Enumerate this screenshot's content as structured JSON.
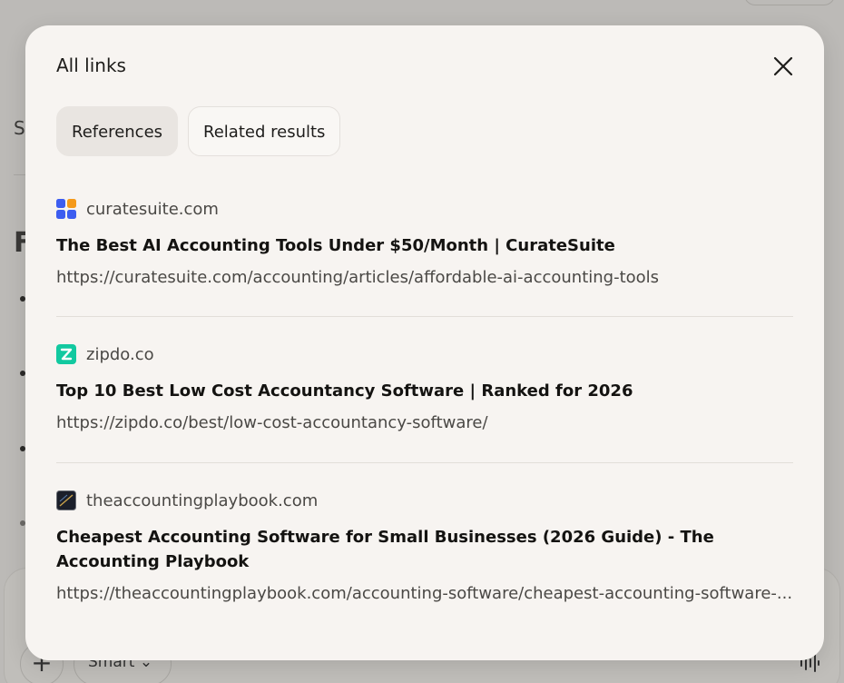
{
  "modal": {
    "title": "All links",
    "close_icon": "close-icon"
  },
  "tabs": [
    {
      "label": "References",
      "active": true
    },
    {
      "label": "Related results",
      "active": false
    }
  ],
  "links": [
    {
      "site": "curatesuite.com",
      "favicon": "curatesuite-logo-icon",
      "title": "The Best AI Accounting Tools Under $50/Month | CurateSuite",
      "url": "https://curatesuite.com/accounting/articles/affordable-ai-accounting-tools"
    },
    {
      "site": "zipdo.co",
      "favicon": "zipdo-logo-icon",
      "title": "Top 10 Best Low Cost Accountancy Software | Ranked for 2026",
      "url": "https://zipdo.co/best/low-cost-accountancy-software/"
    },
    {
      "site": "theaccountingplaybook.com",
      "favicon": "accountingplaybook-logo-icon",
      "title": "Cheapest Accounting Software for Small Businesses (2026 Guide) - The Accounting Playbook",
      "url": "https://theaccountingplaybook.com/accounting-software/cheapest-accounting-software-..."
    }
  ],
  "background": {
    "heading_letter": "S",
    "section_letter": "F",
    "composer": {
      "plus_label": "+",
      "mode_label": "Smart ⌄",
      "voice_icon": "waveform-icon"
    }
  },
  "colors": {
    "modal_bg": "#f7f4f1",
    "active_tab_bg": "#e9e5e1",
    "overlay": "#bcbab7"
  }
}
